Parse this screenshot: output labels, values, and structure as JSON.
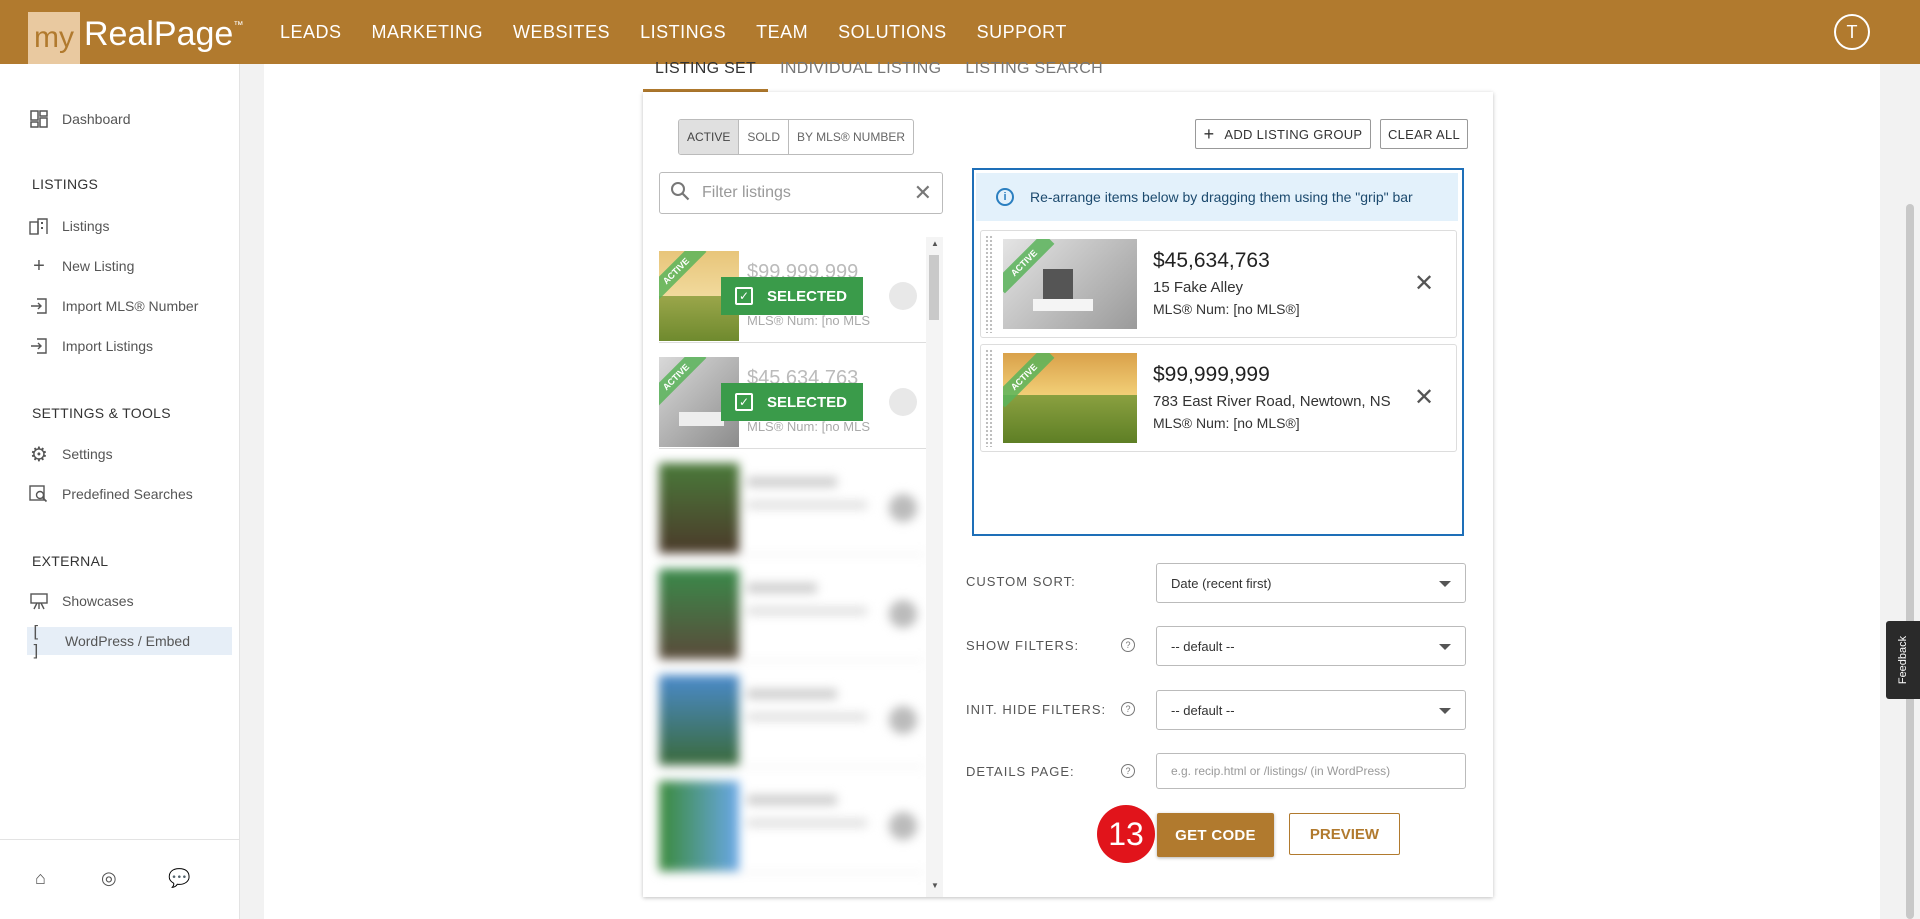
{
  "brand": {
    "logo_my": "my",
    "logo_name": "RealPage",
    "logo_tm": "™"
  },
  "nav": [
    "LEADS",
    "MARKETING",
    "WEBSITES",
    "LISTINGS",
    "TEAM",
    "SOLUTIONS",
    "SUPPORT"
  ],
  "user": {
    "initial": "T"
  },
  "sidebar": {
    "dashboard": "Dashboard",
    "section_listings": "LISTINGS",
    "listings": "Listings",
    "new_listing": "New Listing",
    "import_mls": "Import MLS® Number",
    "import_listings": "Import Listings",
    "section_settings": "SETTINGS & TOOLS",
    "settings": "Settings",
    "predefined": "Predefined Searches",
    "section_external": "EXTERNAL",
    "showcases": "Showcases",
    "wordpress": "WordPress / Embed"
  },
  "tabs": [
    "LISTING SET",
    "INDIVIDUAL LISTING",
    "LISTING SEARCH"
  ],
  "segments": [
    "ACTIVE",
    "SOLD",
    "BY MLS® NUMBER"
  ],
  "filter": {
    "placeholder": "Filter listings"
  },
  "left_list": [
    {
      "price": "$99,999,999",
      "mls": "MLS® Num: [no MLS",
      "status": "ACTIVE",
      "selected_label": "SELECTED"
    },
    {
      "price": "$45,634,763",
      "mls": "MLS® Num: [no MLS",
      "status": "ACTIVE",
      "selected_label": "SELECTED"
    }
  ],
  "actions": {
    "add_group": "ADD LISTING GROUP",
    "clear_all": "CLEAR ALL"
  },
  "info_text": "Re-arrange items below by dragging them using the \"grip\" bar",
  "selected": [
    {
      "price": "$45,634,763",
      "address": "15 Fake Alley",
      "mls": "MLS® Num: [no MLS®]",
      "status": "ACTIVE"
    },
    {
      "price": "$99,999,999",
      "address": "783 East River Road, Newtown, NS",
      "mls": "MLS® Num: [no MLS®]",
      "status": "ACTIVE"
    }
  ],
  "form": {
    "custom_sort_label": "CUSTOM SORT:",
    "custom_sort_value": "Date (recent first)",
    "show_filters_label": "SHOW FILTERS:",
    "show_filters_value": "-- default --",
    "init_hide_label": "INIT. HIDE FILTERS:",
    "init_hide_value": "-- default --",
    "details_label": "DETAILS PAGE:",
    "details_placeholder": "e.g. recip.html or /listings/ (in WordPress)"
  },
  "step_badge": "13",
  "buttons": {
    "get_code": "GET CODE",
    "preview": "PREVIEW"
  },
  "feedback": "Feedback",
  "colors": {
    "brand": "#b17a2e",
    "selected_green": "#3a9b4a",
    "focus_blue": "#1e6fb8",
    "badge_red": "#e1141b"
  }
}
